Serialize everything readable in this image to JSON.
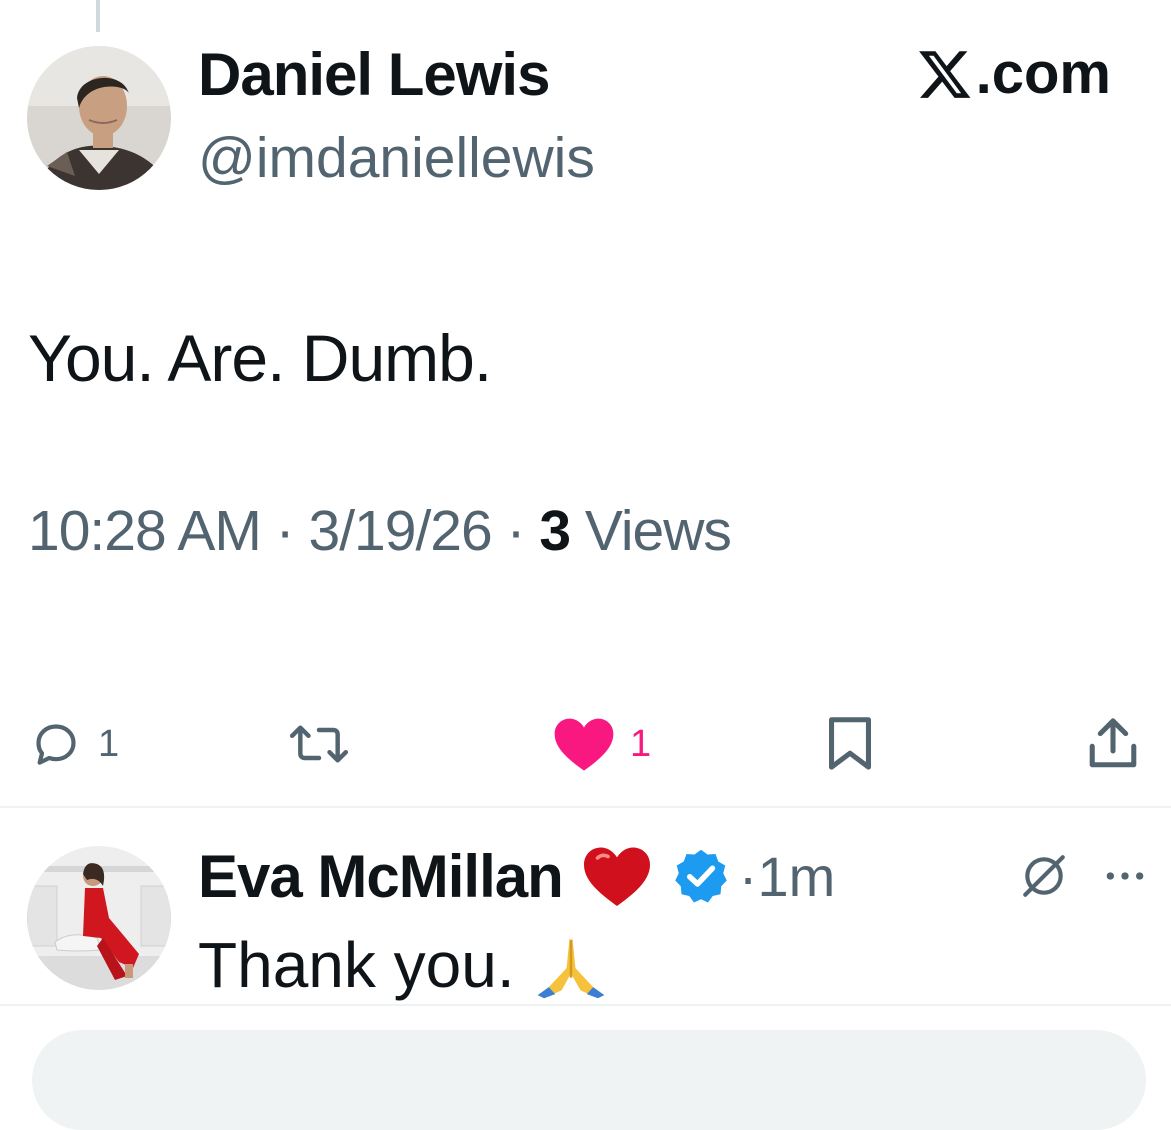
{
  "tweet": {
    "author_name": "Daniel Lewis",
    "author_handle": "@imdaniellewis",
    "brand": "X.com",
    "text": "You. Are. Dumb.",
    "time": "10:28 AM",
    "date": "3/19/26",
    "views_count": "3",
    "views_label": "Views",
    "separator": " · ",
    "avatar_icon": "man-portrait-avatar"
  },
  "actions": {
    "reply": {
      "icon": "reply-bubble-icon",
      "count": "1"
    },
    "repost": {
      "icon": "repost-arrows-icon"
    },
    "like": {
      "icon": "heart-filled-icon",
      "count": "1",
      "color": "#f91880"
    },
    "bookmark": {
      "icon": "bookmark-icon"
    },
    "share": {
      "icon": "share-icon"
    }
  },
  "reply": {
    "author_name": "Eva McMillan",
    "name_emoji": "red-heart-emoji",
    "verified_icon": "verified-badge-icon",
    "verified_color": "#1d9bf0",
    "time": "·1m",
    "text": "Thank you.",
    "text_emoji": "folded-hands-emoji",
    "avatar_icon": "woman-red-dress-avatar",
    "grok_icon": "grok-icon",
    "more_icon": "more-dots-icon"
  },
  "colors": {
    "primary_text": "#0f1419",
    "secondary_text": "#536471",
    "divider": "#eff3f4"
  }
}
